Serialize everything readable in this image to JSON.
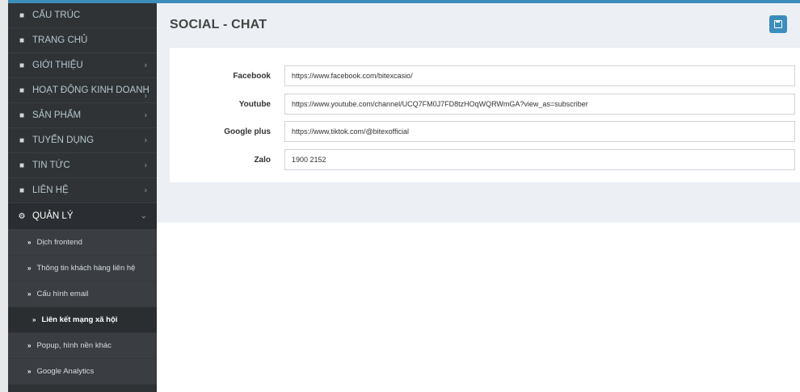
{
  "sidebar": {
    "items": [
      {
        "label": "CẤU TRÚC",
        "icon": "sitemap-icon",
        "chevron": false
      },
      {
        "label": "TRANG CHỦ",
        "icon": "sitemap-icon",
        "chevron": false
      },
      {
        "label": "GIỚI THIỆU",
        "icon": "sitemap-icon",
        "chevron": true
      },
      {
        "label": "HOẠT ĐỘNG KINH DOANH",
        "icon": "sitemap-icon",
        "chevron": true
      },
      {
        "label": "SẢN PHẨM",
        "icon": "sitemap-icon",
        "chevron": true
      },
      {
        "label": "TUYỂN DỤNG",
        "icon": "sitemap-icon",
        "chevron": true
      },
      {
        "label": "TIN TỨC",
        "icon": "sitemap-icon",
        "chevron": true
      },
      {
        "label": "LIÊN HỆ",
        "icon": "sitemap-icon",
        "chevron": true
      }
    ],
    "manage": {
      "label": "QUẢN LÝ",
      "icon": "gear-icon",
      "chevron": "chevron-down-icon"
    },
    "submenu": [
      {
        "label": "Dịch frontend"
      },
      {
        "label": "Thông tin khách hàng liên hệ"
      },
      {
        "label": "Cấu hình email"
      },
      {
        "label": "Liên kết mạng xã hội",
        "current": true
      },
      {
        "label": "Popup, hình nền khác"
      },
      {
        "label": "Google Analytics"
      }
    ]
  },
  "header": {
    "title": "SOCIAL - CHAT",
    "save_icon": "floppy-disk-icon"
  },
  "form": {
    "fields": [
      {
        "label": "Facebook",
        "value": "https://www.facebook.com/bitexcasio/"
      },
      {
        "label": "Youtube",
        "value": "https://www.youtube.com/channel/UCQ7FM0J7FD8tzHOqWQRWmGA?view_as=subscriber"
      },
      {
        "label": "Google plus",
        "value": "https://www.tiktok.com/@bitexofficial"
      },
      {
        "label": "Zalo",
        "value": "1900 2152"
      }
    ]
  },
  "colors": {
    "sidebar_bg": "#2f3336",
    "accent": "#3c8dbc",
    "content_bg": "#ecf0f5"
  }
}
